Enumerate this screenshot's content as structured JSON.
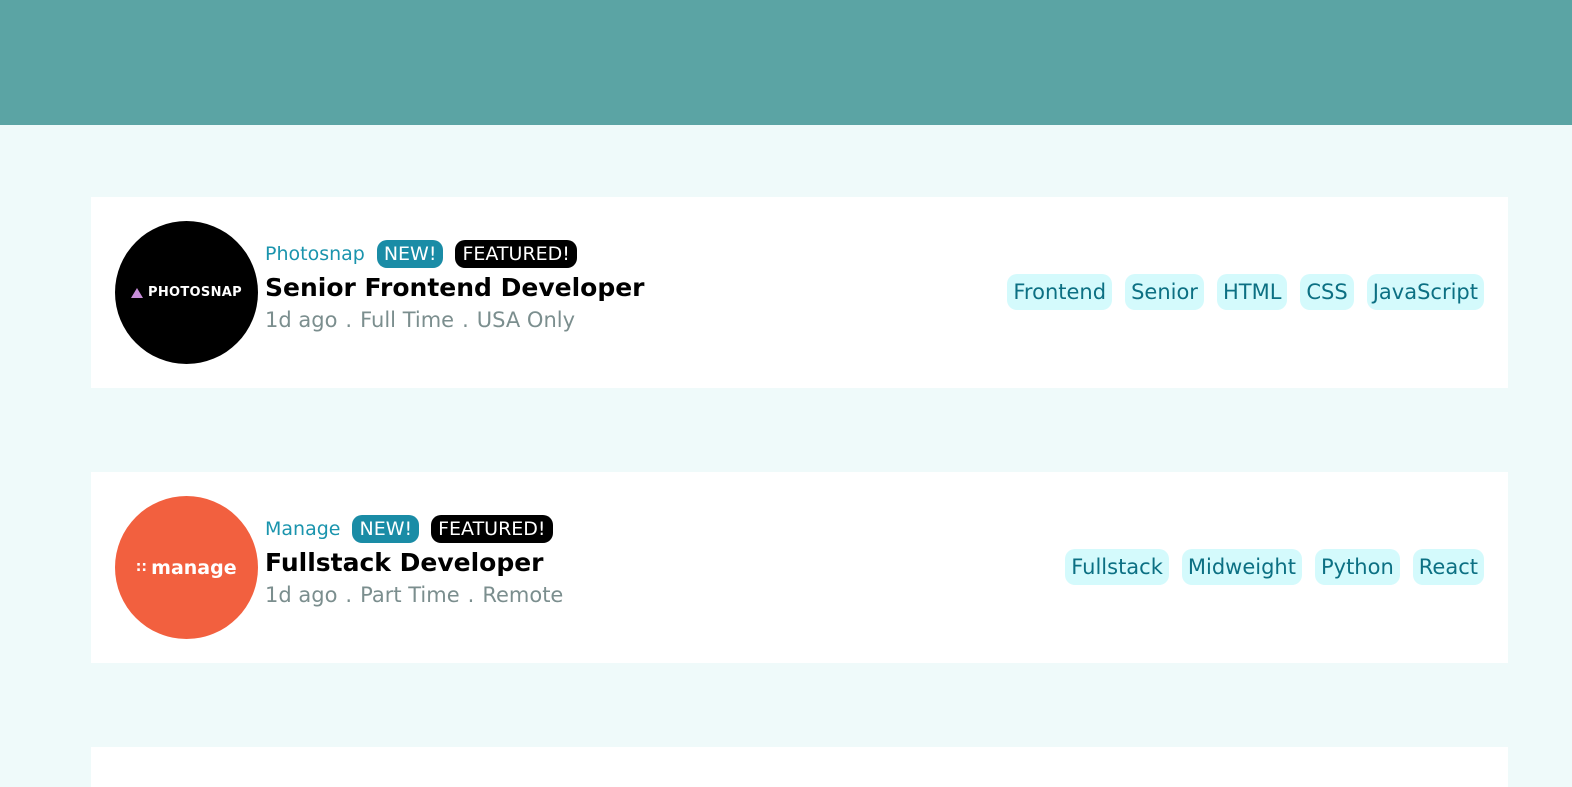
{
  "jobs": [
    {
      "company": "Photosnap",
      "logo_text": "PHOTOSNAP",
      "new_label": "NEW!",
      "featured_label": "FEATURED!",
      "position": "Senior Frontend Developer",
      "posted": "1d ago",
      "contract": "Full Time",
      "location": "USA Only",
      "tags": [
        "Frontend",
        "Senior",
        "HTML",
        "CSS",
        "JavaScript"
      ]
    },
    {
      "company": "Manage",
      "logo_text": "manage",
      "new_label": "NEW!",
      "featured_label": "FEATURED!",
      "position": "Fullstack Developer",
      "posted": "1d ago",
      "contract": "Part Time",
      "location": "Remote",
      "tags": [
        "Fullstack",
        "Midweight",
        "Python",
        "React"
      ]
    }
  ],
  "separator": ".",
  "colors": {
    "header": "#5ba4a4",
    "background": "#effafa",
    "accent": "#1a94ad",
    "tag_bg": "#d4fafc",
    "photosnap_logo": "#000000",
    "manage_logo": "#f2603f"
  }
}
